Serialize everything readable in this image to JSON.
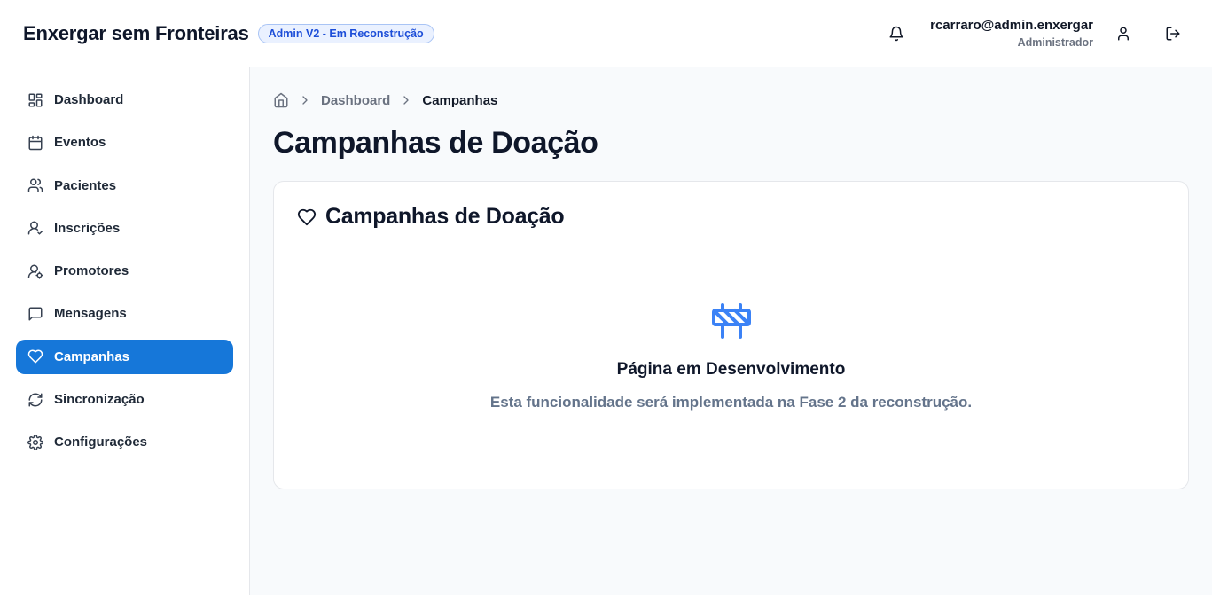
{
  "header": {
    "brand": "Enxergar sem Fronteiras",
    "badge": "Admin V2 - Em Reconstrução",
    "user_email": "rcarraro@admin.enxergar",
    "user_role": "Administrador",
    "icons": [
      "bell-icon",
      "user-icon",
      "logout-icon"
    ]
  },
  "sidebar": {
    "items": [
      {
        "label": "Dashboard",
        "icon": "grid-icon"
      },
      {
        "label": "Eventos",
        "icon": "calendar-icon"
      },
      {
        "label": "Pacientes",
        "icon": "users-icon"
      },
      {
        "label": "Inscrições",
        "icon": "user-check-icon"
      },
      {
        "label": "Promotores",
        "icon": "user-cog-icon"
      },
      {
        "label": "Mensagens",
        "icon": "message-icon"
      },
      {
        "label": "Campanhas",
        "icon": "heart-icon",
        "active": true
      },
      {
        "label": "Sincronização",
        "icon": "sync-icon"
      },
      {
        "label": "Configurações",
        "icon": "settings-icon"
      }
    ]
  },
  "breadcrumb": {
    "items": [
      "Dashboard",
      "Campanhas"
    ]
  },
  "main": {
    "page_title": "Campanhas de Doação",
    "card": {
      "title": "Campanhas de Doação",
      "empty_title": "Página em Desenvolvimento",
      "empty_description": "Esta funcionalidade será implementada na Fase 2 da reconstrução."
    }
  },
  "colors": {
    "accent": "#1677d9",
    "badge_text": "#1d4ed8",
    "barrier_icon": "#3b82f6",
    "muted_text": "#64748b"
  }
}
